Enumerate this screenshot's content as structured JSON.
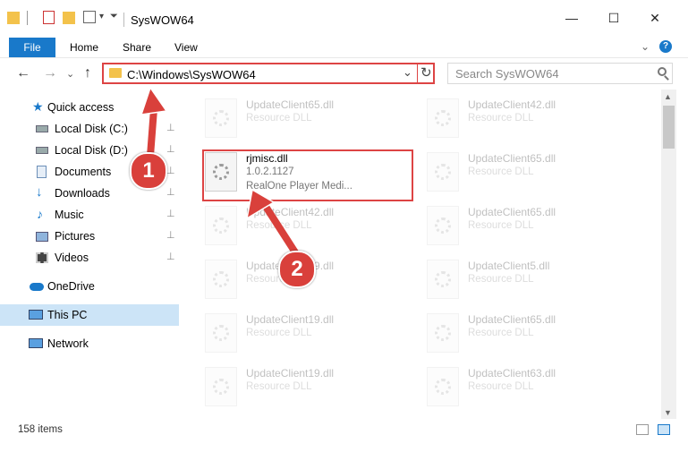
{
  "window": {
    "title": "SysWOW64",
    "minimize": "—",
    "maximize": "☐",
    "close": "✕"
  },
  "ribbon": {
    "file": "File",
    "tabs": [
      "Home",
      "Share",
      "View"
    ],
    "expand": "⌄",
    "help": "?"
  },
  "nav": {
    "back": "←",
    "forward": "→",
    "recent": "⌄",
    "up": "↑",
    "address": "C:\\Windows\\SysWOW64",
    "address_dropdown": "⌄",
    "refresh": "↻",
    "search_placeholder": "Search SysWOW64"
  },
  "sidebar": {
    "items": [
      {
        "label": "Quick access",
        "icon": "star-icon",
        "pinned": false
      },
      {
        "label": "Local Disk (C:)",
        "icon": "drive-icon",
        "pinned": true
      },
      {
        "label": "Local Disk (D:)",
        "icon": "drive-icon",
        "pinned": true
      },
      {
        "label": "Documents",
        "icon": "documents-icon",
        "pinned": true
      },
      {
        "label": "Downloads",
        "icon": "download-icon",
        "pinned": true
      },
      {
        "label": "Music",
        "icon": "music-icon",
        "pinned": true
      },
      {
        "label": "Pictures",
        "icon": "pictures-icon",
        "pinned": true
      },
      {
        "label": "Videos",
        "icon": "videos-icon",
        "pinned": true
      },
      {
        "label": "OneDrive",
        "icon": "cloud-icon",
        "pinned": false
      },
      {
        "label": "This PC",
        "icon": "computer-icon",
        "pinned": false,
        "selected": true
      },
      {
        "label": "Network",
        "icon": "network-icon",
        "pinned": false
      }
    ],
    "pin_glyph": "📌"
  },
  "files": {
    "highlighted": {
      "name": "rjmisc.dll",
      "version": "1.0.2.1127",
      "description": "RealOne Player Medi..."
    },
    "left_column": [
      {
        "name": "UpdateClient65.dll",
        "type": "Resource DLL"
      },
      {
        "name": "UpdateClient42.dll",
        "type": "Resource DLL"
      },
      {
        "name": "UpdateClient19.dll",
        "type": "Resource DLL"
      },
      {
        "name": "UpdateClient19.dll",
        "type": "Resource DLL"
      },
      {
        "name": "UpdateClient19.dll",
        "type": "Resource DLL"
      }
    ],
    "right_column": [
      {
        "name": "UpdateClient42.dll",
        "type": "Resource DLL"
      },
      {
        "name": "UpdateClient65.dll",
        "type": "Resource DLL"
      },
      {
        "name": "UpdateClient65.dll",
        "type": "Resource DLL"
      },
      {
        "name": "UpdateClient5.dll",
        "type": "Resource DLL"
      },
      {
        "name": "UpdateClient65.dll",
        "type": "Resource DLL"
      },
      {
        "name": "UpdateClient63.dll",
        "type": "Resource DLL"
      }
    ]
  },
  "status": {
    "count": "158 items"
  },
  "callouts": [
    "1",
    "2"
  ],
  "colors": {
    "accent": "#1979ca",
    "highlight_border": "#dd4444",
    "callout": "#d9403b",
    "selected_nav": "#cce4f7"
  }
}
